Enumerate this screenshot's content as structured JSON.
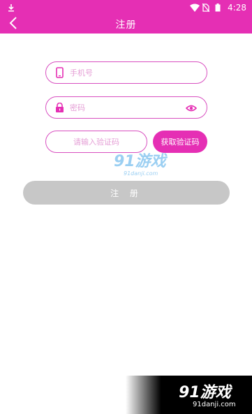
{
  "status": {
    "time": "4:28"
  },
  "header": {
    "title": "注册"
  },
  "form": {
    "phone_placeholder": "手机号",
    "password_placeholder": "密码",
    "code_placeholder": "请输入验证码",
    "get_code_label": "获取验证码",
    "register_label": "注 册"
  },
  "watermark": {
    "brand": "91游戏",
    "domain": "91danji.com"
  },
  "colors": {
    "accent": "#e52fb4",
    "border": "#d84fc0",
    "disabled_button": "#c7c7c7"
  },
  "icons": [
    "download-icon",
    "wifi-icon",
    "no-sim-icon",
    "battery-icon",
    "back-arrow-icon",
    "phone-icon",
    "lock-icon",
    "eye-icon"
  ]
}
